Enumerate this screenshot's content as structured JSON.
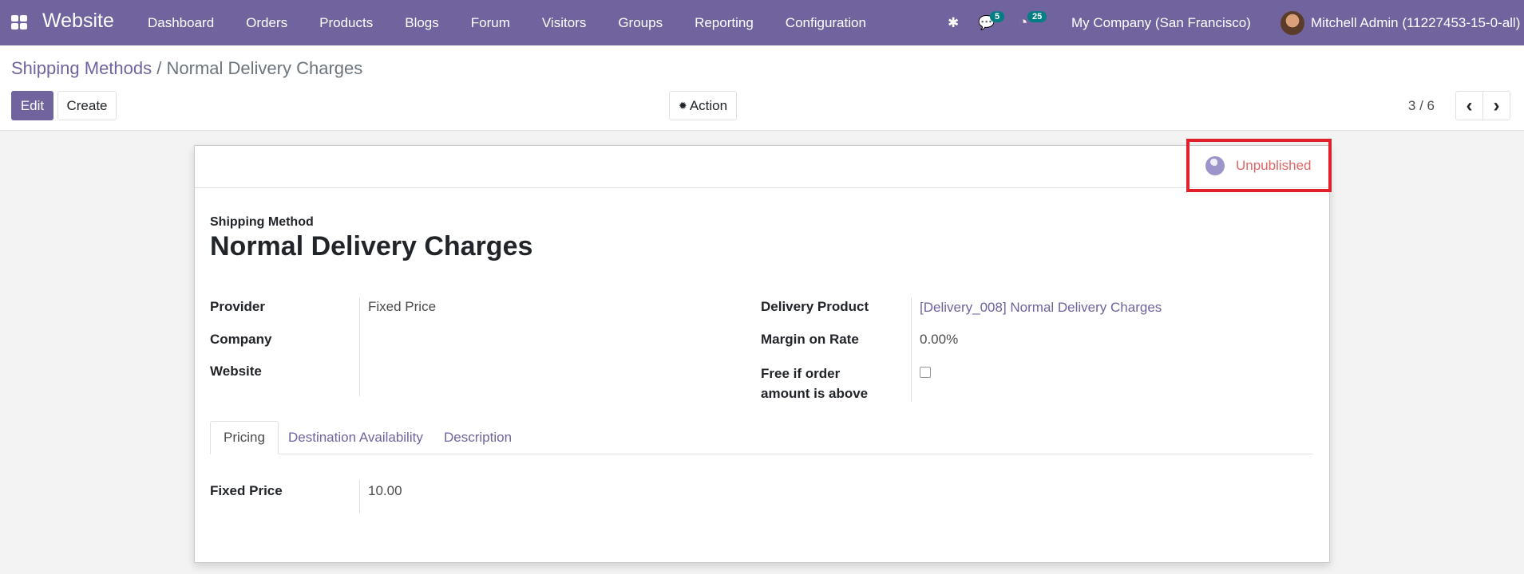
{
  "navbar": {
    "app_name": "Website",
    "menu": [
      "Dashboard",
      "Orders",
      "Products",
      "Blogs",
      "Forum",
      "Visitors",
      "Groups",
      "Reporting",
      "Configuration"
    ],
    "messages_count": "5",
    "activities_count": "25",
    "company": "My Company (San Francisco)",
    "user": "Mitchell Admin (11227453-15-0-all)"
  },
  "breadcrumb": {
    "parent": "Shipping Methods",
    "separator": "/",
    "current": "Normal Delivery Charges"
  },
  "toolbar": {
    "edit": "Edit",
    "create": "Create",
    "action": "Action",
    "pager": "3 / 6",
    "prev": "‹",
    "next": "›"
  },
  "status": {
    "published_label": "Unpublished"
  },
  "form": {
    "subtitle": "Shipping Method",
    "title": "Normal Delivery Charges",
    "left": [
      {
        "label": "Provider",
        "value": "Fixed Price"
      },
      {
        "label": "Company",
        "value": ""
      },
      {
        "label": "Website",
        "value": ""
      }
    ],
    "right": [
      {
        "label": "Delivery Product",
        "value": "[Delivery_008] Normal Delivery Charges"
      },
      {
        "label": "Margin on Rate",
        "value": "0.00%"
      },
      {
        "label": "Free if order amount is above",
        "value": false
      }
    ],
    "tabs": [
      "Pricing",
      "Destination Availability",
      "Description"
    ],
    "pricing": {
      "label": "Fixed Price",
      "value": "10.00"
    }
  }
}
